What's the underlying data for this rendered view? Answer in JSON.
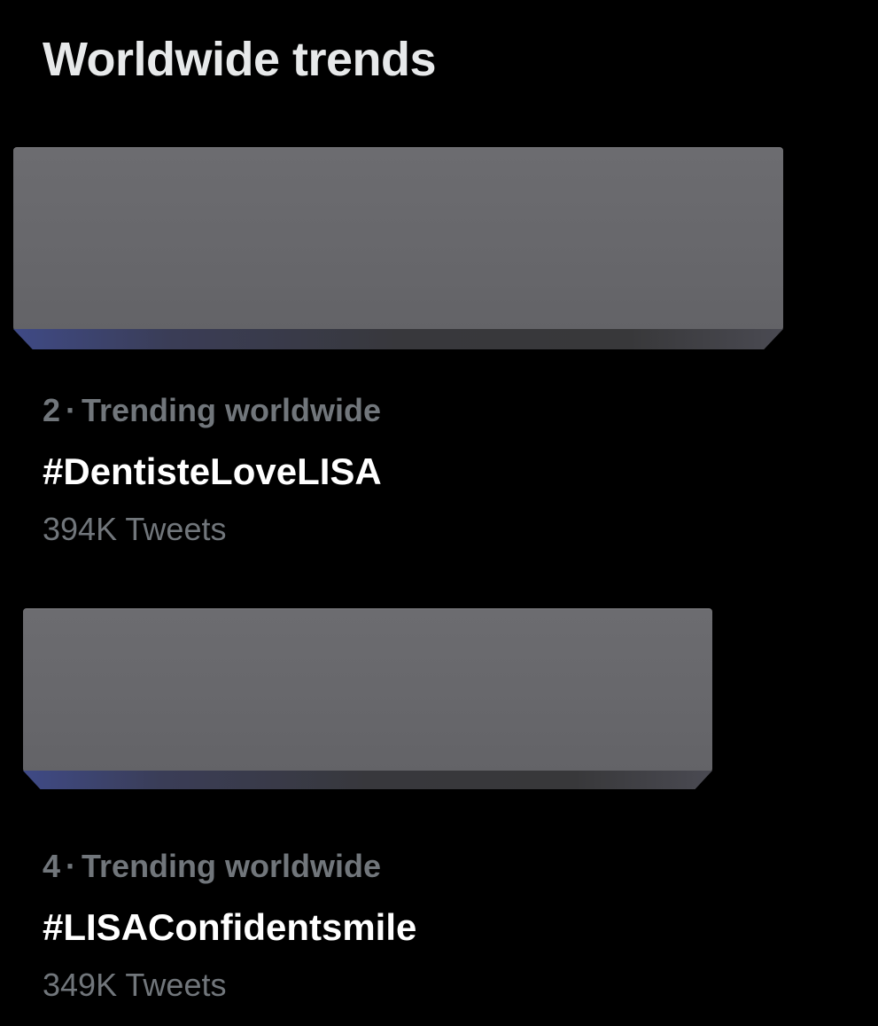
{
  "header": {
    "title": "Worldwide trends"
  },
  "trends": [
    {
      "rank": "2",
      "separator": "·",
      "context": "Trending worldwide",
      "name": "#DentisteLoveLISA",
      "count": "394K Tweets"
    },
    {
      "rank": "4",
      "separator": "·",
      "context": "Trending worldwide",
      "name": "#LISAConfidentsmile",
      "count": "349K Tweets"
    }
  ],
  "colors": {
    "background": "#000000",
    "primary_text": "#ffffff",
    "secondary_text": "#71767b",
    "block_gray": "#6a6a6e"
  }
}
